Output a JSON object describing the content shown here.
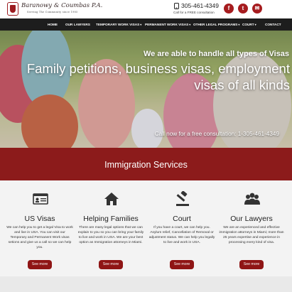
{
  "header": {
    "logo_name": "Baranowy & Coumbas P.A.",
    "logo_tagline": "Serving The Community since 1985",
    "phone": "305-461-4349",
    "consult_text": "Call for a FREE consultation",
    "social": [
      {
        "name": "facebook",
        "glyph": "f"
      },
      {
        "name": "twitter",
        "glyph": "t"
      },
      {
        "name": "email",
        "glyph": "✉"
      }
    ]
  },
  "nav": {
    "items": [
      {
        "label": "HOME"
      },
      {
        "label": "OUR LAWYERS"
      },
      {
        "label": "TEMPORARY WORK VISAS",
        "dropdown": "▾"
      },
      {
        "label": "PERMANENT WORK VISAS",
        "dropdown": "▾"
      },
      {
        "label": "OTHER LEGAL PROGRAMS",
        "dropdown": "▾"
      },
      {
        "label": "COURT",
        "dropdown": "▾"
      },
      {
        "label": "CONTACT"
      }
    ]
  },
  "hero": {
    "line1": "We are able to handle all types of Visas",
    "line2": "Family petitions, business visas, employment visas of all kinds",
    "line3": "Call now for a free consultation: 1-305-461-4349"
  },
  "band": {
    "title": "Immigration Services"
  },
  "services": [
    {
      "icon": "visa-card-icon",
      "title": "US Visas",
      "desc": "We can help you to get a legal Visa to work and live in USA. You can visit our Temporary and Permanent Work visas setions and give us a call so we can help you.",
      "button": "See more"
    },
    {
      "icon": "house-icon",
      "title": "Helping Families",
      "desc": "There are many legal options that we can explain to you so you can bring your family to live and work in USA. We are your best option as Immigration attorneys in Miami.",
      "button": "See more"
    },
    {
      "icon": "gavel-icon",
      "title": "Court",
      "desc": "If you have a court, we can help you. Asylum relief, Cancellation of Removal or adjustment status. We can help you legally to live and work in USA.",
      "button": "See more"
    },
    {
      "icon": "people-icon",
      "title": "Our Lawyers",
      "desc": "We are an experienced and effective immigration attorneys in Miami; more than 25 years expertise and experience in processing every kind of visa.",
      "button": "See more"
    }
  ],
  "colors": {
    "accent": "#8c1b1b",
    "nav_bg": "#1d1d1d",
    "services_bg": "#f3f3f3"
  }
}
